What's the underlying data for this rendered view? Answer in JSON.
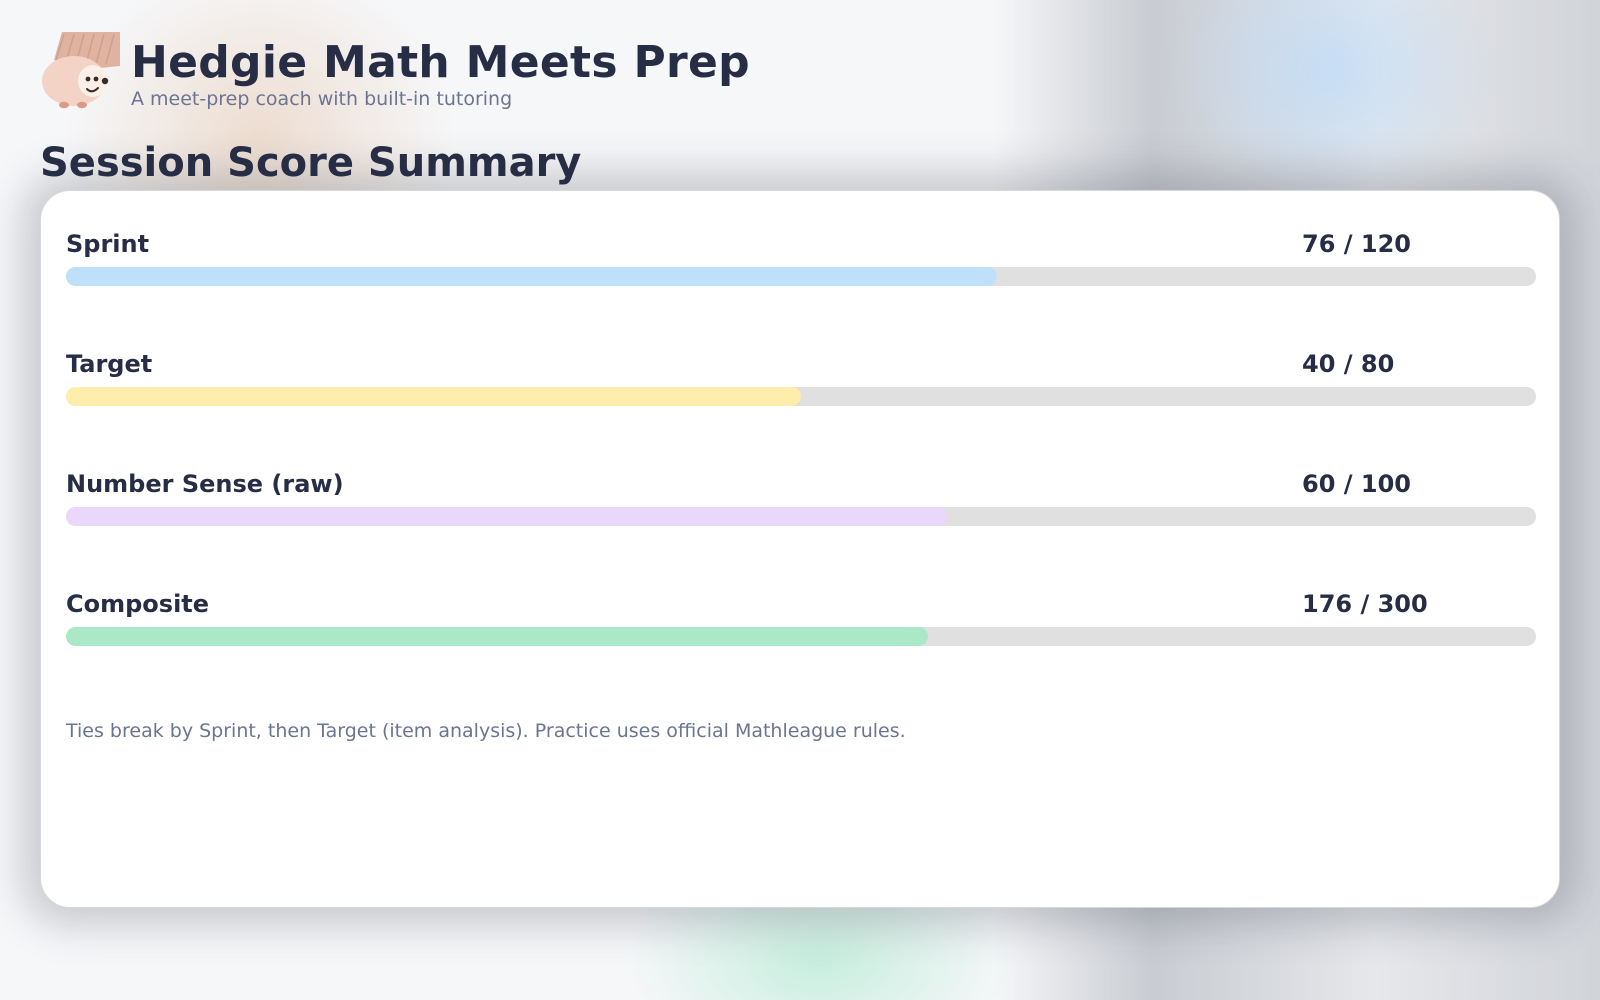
{
  "app": {
    "title": "Hedgie Math Meets Prep",
    "subtitle": "A meet-prep coach with built-in tutoring",
    "logo_icon": "hedgehog-mascot-icon"
  },
  "section": {
    "title": "Session Score Summary"
  },
  "metrics": [
    {
      "label": "Sprint",
      "value_text": "76 / 120",
      "score": 76,
      "max": 120,
      "color": "#bee0fa"
    },
    {
      "label": "Target",
      "value_text": "40 / 80",
      "score": 40,
      "max": 80,
      "color": "#ffeeab"
    },
    {
      "label": "Number Sense (raw)",
      "value_text": "60 / 100",
      "score": 60,
      "max": 100,
      "color": "#ead8fc"
    },
    {
      "label": "Composite",
      "value_text": "176 / 300",
      "score": 176,
      "max": 300,
      "color": "#aae8c8"
    }
  ],
  "footnote": "Ties break by Sprint, then Target (item analysis). Practice uses official Mathleague rules."
}
